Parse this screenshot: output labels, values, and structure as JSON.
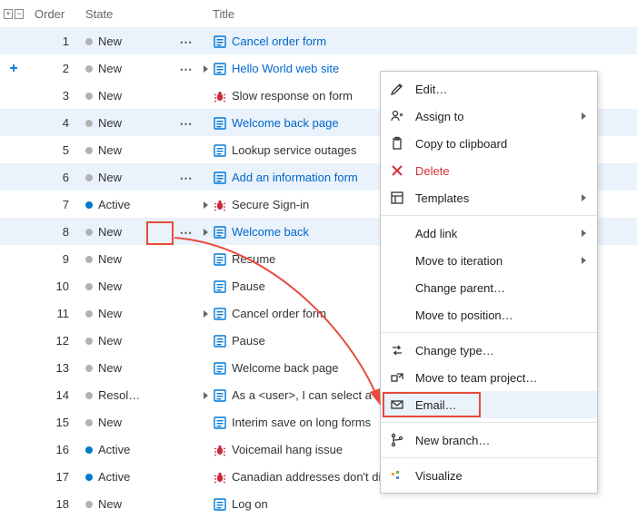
{
  "columns": {
    "order": "Order",
    "state": "State",
    "title": "Title"
  },
  "states": {
    "new": "New",
    "active": "Active",
    "resolved": "Resol…"
  },
  "rows": [
    {
      "order": 1,
      "state": "new",
      "type": "pbi",
      "link": true,
      "title": "Cancel order form",
      "selected": true,
      "actions": true,
      "caret": false
    },
    {
      "order": 2,
      "state": "new",
      "type": "pbi",
      "link": true,
      "title": "Hello World web site",
      "selected": false,
      "actions": true,
      "caret": true,
      "addRow": true
    },
    {
      "order": 3,
      "state": "new",
      "type": "bug",
      "link": false,
      "title": "Slow response on form",
      "selected": false,
      "actions": false,
      "caret": false
    },
    {
      "order": 4,
      "state": "new",
      "type": "pbi",
      "link": true,
      "title": "Welcome back page",
      "selected": true,
      "actions": true,
      "caret": false
    },
    {
      "order": 5,
      "state": "new",
      "type": "pbi",
      "link": false,
      "title": "Lookup service outages",
      "selected": false,
      "actions": false,
      "caret": false
    },
    {
      "order": 6,
      "state": "new",
      "type": "pbi",
      "link": true,
      "title": "Add an information form",
      "selected": true,
      "actions": true,
      "caret": false
    },
    {
      "order": 7,
      "state": "active",
      "type": "bug",
      "link": false,
      "title": "Secure Sign-in",
      "selected": false,
      "actions": false,
      "caret": true
    },
    {
      "order": 8,
      "state": "new",
      "type": "pbi",
      "link": true,
      "title": "Welcome back",
      "selected": true,
      "actions": true,
      "caret": true,
      "actionBox": true
    },
    {
      "order": 9,
      "state": "new",
      "type": "pbi",
      "link": false,
      "title": "Resume",
      "selected": false,
      "actions": false,
      "caret": false
    },
    {
      "order": 10,
      "state": "new",
      "type": "pbi",
      "link": false,
      "title": "Pause",
      "selected": false,
      "actions": false,
      "caret": false
    },
    {
      "order": 11,
      "state": "new",
      "type": "pbi",
      "link": false,
      "title": "Cancel order form",
      "selected": false,
      "actions": false,
      "caret": true
    },
    {
      "order": 12,
      "state": "new",
      "type": "pbi",
      "link": false,
      "title": "Pause",
      "selected": false,
      "actions": false,
      "caret": false
    },
    {
      "order": 13,
      "state": "new",
      "type": "pbi",
      "link": false,
      "title": "Welcome back page",
      "selected": false,
      "actions": false,
      "caret": false
    },
    {
      "order": 14,
      "state": "resolved",
      "type": "pbi",
      "link": false,
      "title": "As a <user>, I can select a number",
      "selected": false,
      "actions": false,
      "caret": true
    },
    {
      "order": 15,
      "state": "new",
      "type": "pbi",
      "link": false,
      "title": "Interim save on long forms",
      "selected": false,
      "actions": false,
      "caret": false
    },
    {
      "order": 16,
      "state": "active",
      "type": "bug",
      "link": false,
      "title": "Voicemail hang issue",
      "selected": false,
      "actions": false,
      "caret": false
    },
    {
      "order": 17,
      "state": "active",
      "type": "bug",
      "link": false,
      "title": "Canadian addresses don't display",
      "selected": false,
      "actions": false,
      "caret": false
    },
    {
      "order": 18,
      "state": "new",
      "type": "pbi",
      "link": false,
      "title": "Log on",
      "selected": false,
      "actions": false,
      "caret": false
    }
  ],
  "menu": {
    "edit": "Edit…",
    "assign": "Assign to",
    "copy": "Copy to clipboard",
    "delete": "Delete",
    "templates": "Templates",
    "addlink": "Add link",
    "moveiter": "Move to iteration",
    "changeparent": "Change parent…",
    "movepos": "Move to position…",
    "changetype": "Change type…",
    "moveteam": "Move to team project…",
    "email": "Email…",
    "newbranch": "New branch…",
    "visualize": "Visualize"
  }
}
